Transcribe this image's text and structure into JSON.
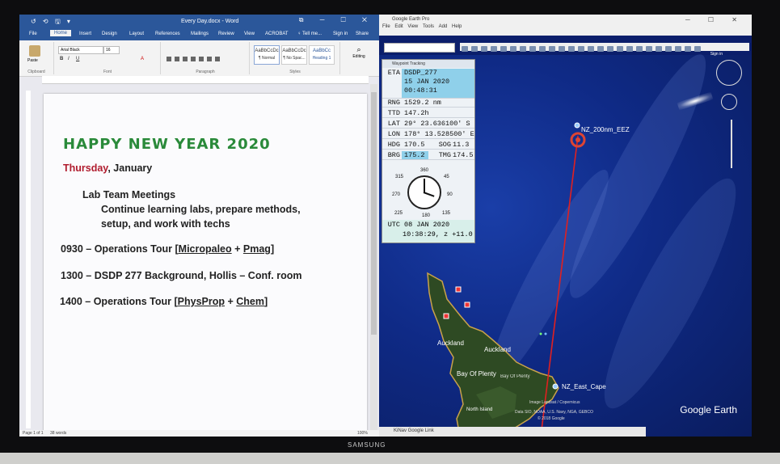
{
  "monitor": {
    "brand": "SAMSUNG"
  },
  "word": {
    "qat_icons": "↺ ⟲ 🖫 ▾",
    "title": "Every Day.docx - Word",
    "window_controls": "⧉ ─ ☐ ✕",
    "tabs": [
      {
        "label": "File"
      },
      {
        "label": "Home"
      },
      {
        "label": "Insert"
      },
      {
        "label": "Design"
      },
      {
        "label": "Layout"
      },
      {
        "label": "References"
      },
      {
        "label": "Mailings"
      },
      {
        "label": "Review"
      },
      {
        "label": "View"
      },
      {
        "label": "ACROBAT"
      },
      {
        "label": "♀ Tell me..."
      },
      {
        "label": "Sign in"
      },
      {
        "label": "Share"
      }
    ],
    "ribbon": {
      "paste": "Paste",
      "clipboard": "Clipboard",
      "font_name": "Arial Black",
      "font_size": "16",
      "font_group": "Font",
      "paragraph_group": "Paragraph",
      "styles_group": "Styles",
      "editing": "Editing",
      "styles": [
        {
          "sample": "AaBbCcDc",
          "name": "¶ Normal"
        },
        {
          "sample": "AaBbCcDc",
          "name": "¶ No Spac..."
        },
        {
          "sample": "AaBbCc",
          "name": "Heading 1"
        }
      ]
    },
    "document": {
      "heading": "HAPPY NEW YEAR 2020",
      "day": "Thursday",
      "month": ", January",
      "meeting_title": "Lab Team Meetings",
      "meeting_line1": "Continue learning labs, prepare methods,",
      "meeting_line2": "setup, and work with techs",
      "item1_prefix": "0930 – Operations Tour [",
      "item1_a": "Micropaleo",
      "item1_plus": " + ",
      "item1_b": "Pmag",
      "item1_suffix": "]",
      "item2": "1300 – DSDP 277 Background, Hollis – Conf. room",
      "item3_prefix": "1400 – Operations Tour [",
      "item3_a": "PhysProp",
      "item3_plus": " + ",
      "item3_b": "Chem",
      "item3_suffix": "]"
    },
    "status": {
      "page": "Page 1 of 1",
      "words": "38 words",
      "zoom": "100%"
    }
  },
  "earth": {
    "title": "Google Earth Pro",
    "window_controls": "─ ☐ ✕",
    "menu": [
      "File",
      "Edit",
      "View",
      "Tools",
      "Add",
      "Help"
    ],
    "signin": "Sign in",
    "labels": {
      "eez": "NZ_200nm_EEZ",
      "cape": "NZ_East_Cape",
      "auckland1": "Auckland",
      "auckland2": "Auckland",
      "bay": "Bay Of Plenty",
      "bay2": "Bay Of Plenty",
      "north_island": "North Island"
    },
    "attribution": {
      "line1": "Image Landsat / Copernicus",
      "line2": "Data SIO, NOAA, U.S. Navy, NGA, GEBCO",
      "line3": "© 2018 Google"
    },
    "logo": "Google Earth",
    "taskbar_item": "KiNav Google Link"
  },
  "waypoint": {
    "title": "Waypoint Tracking",
    "eta_key": "ETA",
    "eta_name": "DSDP_277",
    "eta_date": "15 JAN 2020",
    "eta_time": "00:48:31",
    "rng_key": "RNG",
    "rng": "1529.2 nm",
    "ttd_key": "TTD",
    "ttd": "147.2h",
    "lat_key": "LAT",
    "lat": "29° 23.636100' S",
    "lon_key": "LON",
    "lon": "178° 13.528500' E",
    "hdg_key": "HDG",
    "hdg": "170.5",
    "sog_key": "SOG",
    "sog": "11.3",
    "brg_key": "BRG",
    "brg": "175.2",
    "tmg_key": "TMG",
    "tmg": "174.5",
    "dial": {
      "n": "360",
      "ne": "45",
      "e": "90",
      "se": "135",
      "s": "180",
      "sw": "225",
      "w": "270",
      "nw": "315"
    },
    "utc_key": "UTC",
    "utc_date": "08 JAN 2020",
    "utc_time": "10:38:29, z +11.0"
  },
  "colors": {
    "word_blue": "#2b579a",
    "heading_green": "#2a8a3a",
    "day_red": "#b01c2e",
    "route_red": "#e02020",
    "panel_highlight": "#8fd0ea"
  }
}
